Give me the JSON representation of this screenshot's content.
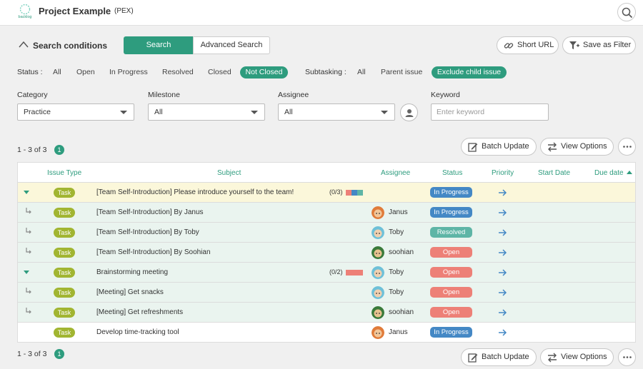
{
  "header": {
    "logo_text": "backlog",
    "project_name": "Project Example",
    "project_key": "(PEX)"
  },
  "search_conditions": {
    "title": "Search conditions",
    "tab_search": "Search",
    "tab_advanced": "Advanced Search",
    "short_url": "Short URL",
    "save_filter": "Save as Filter",
    "status_label": "Status :",
    "status_options": [
      "All",
      "Open",
      "In Progress",
      "Resolved",
      "Closed",
      "Not Closed"
    ],
    "status_selected": "Not Closed",
    "subtasking_label": "Subtasking :",
    "subtasking_options": [
      "All",
      "Parent issue",
      "Exclude child issue"
    ],
    "subtasking_selected": "Exclude child issue",
    "category_label": "Category",
    "category_value": "Practice",
    "milestone_label": "Milestone",
    "milestone_value": "All",
    "assignee_label": "Assignee",
    "assignee_value": "All",
    "keyword_label": "Keyword",
    "keyword_placeholder": "Enter keyword"
  },
  "results": {
    "range_text": "1 - 3 of 3",
    "page": "1",
    "batch_update": "Batch Update",
    "view_options": "View Options"
  },
  "table": {
    "columns": [
      "Issue Type",
      "Subject",
      "Assignee",
      "Status",
      "Priority",
      "Start Date",
      "Due date"
    ],
    "rows": [
      {
        "kind": "parent-open",
        "type": "Task",
        "subject": "[Team Self-Introduction] Please introduce yourself to the team!",
        "subtasks": "(0/3)",
        "assignee": "",
        "status": "In Progress"
      },
      {
        "kind": "child",
        "type": "Task",
        "subject": "[Team Self-Introduction] By Janus",
        "assignee": "Janus",
        "status": "In Progress"
      },
      {
        "kind": "child",
        "type": "Task",
        "subject": "[Team Self-Introduction] By Toby",
        "assignee": "Toby",
        "status": "Resolved"
      },
      {
        "kind": "child",
        "type": "Task",
        "subject": "[Team Self-Introduction] By Soohian",
        "assignee": "soohian",
        "status": "Open"
      },
      {
        "kind": "group",
        "type": "Task",
        "subject": "Brainstorming meeting",
        "subtasks": "(0/2)",
        "assignee": "Toby",
        "status": "Open"
      },
      {
        "kind": "child",
        "type": "Task",
        "subject": "[Meeting] Get snacks",
        "assignee": "Toby",
        "status": "Open"
      },
      {
        "kind": "child",
        "type": "Task",
        "subject": "[Meeting] Get refreshments",
        "assignee": "soohian",
        "status": "Open"
      },
      {
        "kind": "plain",
        "type": "Task",
        "subject": "Develop time-tracking tool",
        "assignee": "Janus",
        "status": "In Progress"
      }
    ]
  },
  "colors": {
    "accent": "#2e9c7e",
    "task": "#a1b531",
    "in_progress": "#4488c5",
    "resolved": "#5eb5a6",
    "open": "#ed8077",
    "priority": "#4488c5",
    "selected_row": "#fbf7da",
    "child_row": "#eaf4ef"
  }
}
